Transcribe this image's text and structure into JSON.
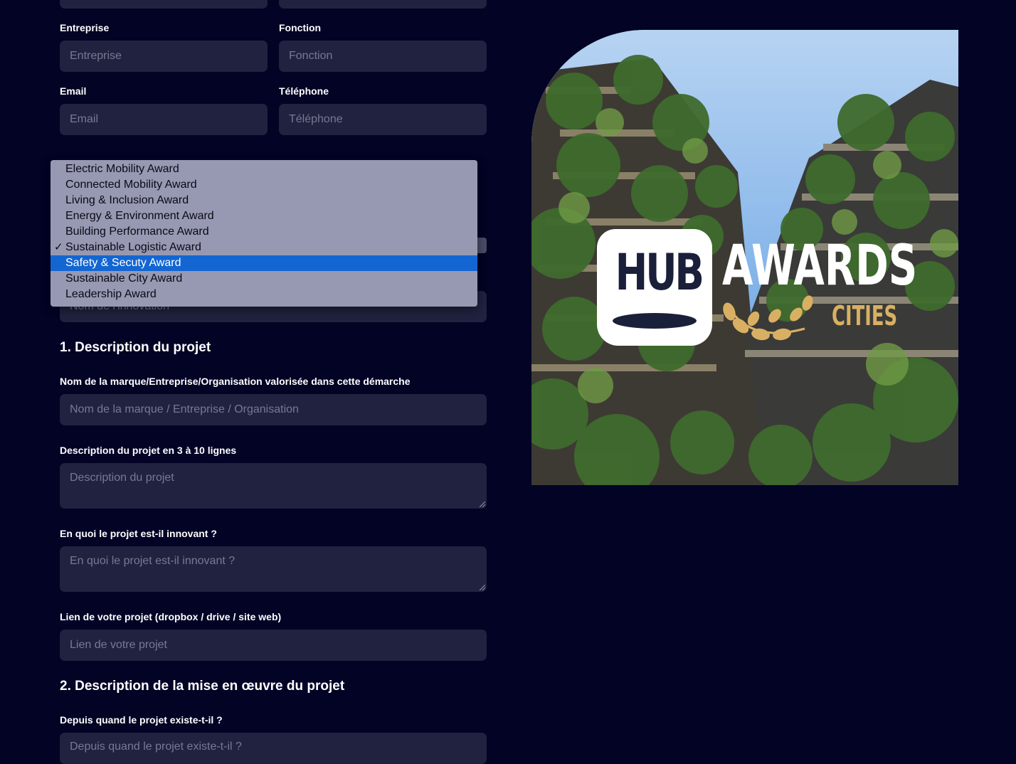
{
  "form": {
    "entreprise": {
      "label": "Entreprise",
      "placeholder": "Entreprise"
    },
    "fonction": {
      "label": "Fonction",
      "placeholder": "Fonction"
    },
    "email": {
      "label": "Email",
      "placeholder": "Email"
    },
    "telephone": {
      "label": "Téléphone",
      "placeholder": "Téléphone"
    },
    "innovation": {
      "placeholder": "Nom de l'innovation"
    },
    "section1": {
      "heading": "1. Description du projet",
      "marque": {
        "label": "Nom de la marque/Entreprise/Organisation valorisée dans cette démarche",
        "placeholder": "Nom de la marque / Entreprise / Organisation"
      },
      "description": {
        "label": "Description du projet en 3 à 10 lignes",
        "placeholder": "Description du projet"
      },
      "innovant": {
        "label": "En quoi le projet est-il innovant ?",
        "placeholder": "En quoi le projet est-il innovant ?"
      },
      "lien": {
        "label": "Lien de votre projet (dropbox / drive / site web)",
        "placeholder": "Lien de votre projet"
      }
    },
    "section2": {
      "heading": "2. Description de la mise en œuvre du projet",
      "depuis": {
        "label": "Depuis quand le projet existe-t-il ?",
        "placeholder": "Depuis quand le projet existe-t-il ?"
      }
    }
  },
  "award_dropdown": {
    "checked": "Sustainable Logistic Award",
    "highlighted": "Safety & Secuty Award",
    "options": [
      "Electric Mobility Award",
      "Connected Mobility Award",
      "Living & Inclusion Award",
      "Energy & Environment Award",
      "Building Performance Award",
      "Sustainable Logistic Award",
      "Safety & Secuty Award",
      "Sustainable City Award",
      "Leadership Award"
    ]
  },
  "hero": {
    "logo_hub": "HUB",
    "logo_awards": "AWARDS",
    "logo_cities": "CITIES"
  },
  "colors": {
    "background": "#020325",
    "field": "#20223f",
    "highlight": "#1366d2",
    "gold": "#d9b063"
  }
}
